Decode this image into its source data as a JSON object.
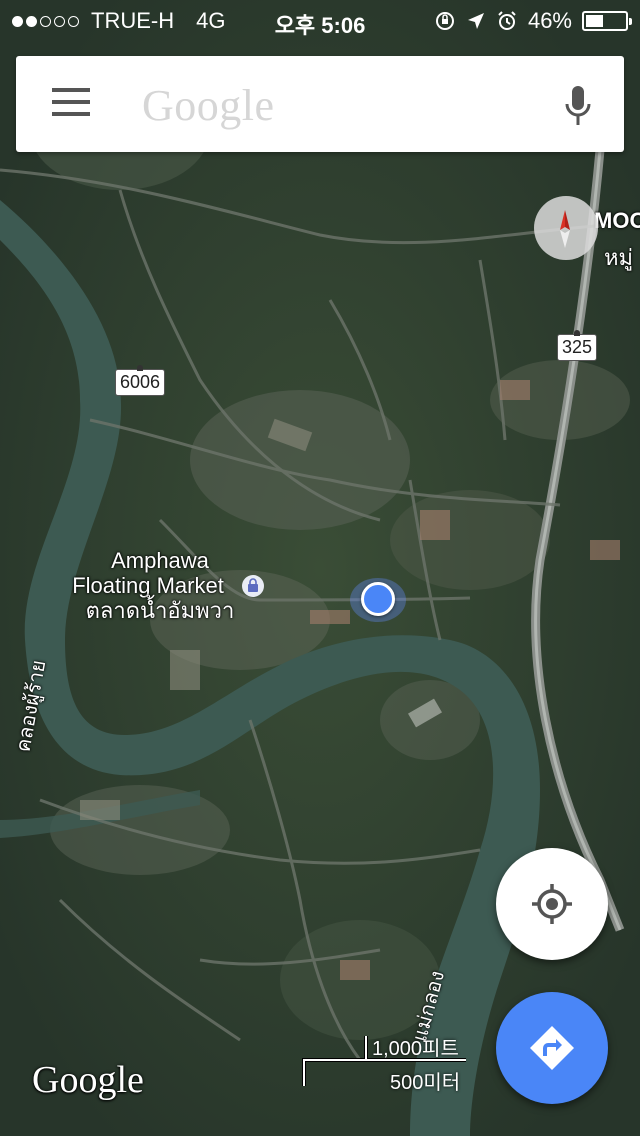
{
  "status_bar": {
    "carrier": "TRUE-H",
    "network": "4G",
    "time": "오후 5:06",
    "battery": "46%",
    "battery_level": 0.46,
    "signal_strength": 2,
    "signal_max": 5
  },
  "search": {
    "logo_text": "Google",
    "menu_icon": "hamburger-menu-icon",
    "mic_icon": "microphone-icon"
  },
  "compass_icon": "compass-icon",
  "map": {
    "place_name_en_1": "Amphawa",
    "place_name_en_2": "Floating Market",
    "place_name_th": "ตลาดน้ำอัมพวา",
    "road_6006": "6006",
    "road_325": "325",
    "label_moo": "MOO",
    "label_mu": "หมู่",
    "river_label_left": "คลองผู้ร้าย",
    "river_label_bottom": "แม่กลอง",
    "place_icon": "shopping-bag-icon"
  },
  "scale": {
    "feet": "1,000피트",
    "meters": "500미터"
  },
  "attribution": "Google",
  "buttons": {
    "my_location_icon": "my-location-icon",
    "directions_icon": "directions-icon"
  },
  "colors": {
    "accent": "#4a86f7",
    "river": "#3d5a52",
    "vegetation": "#2f3f2c"
  }
}
